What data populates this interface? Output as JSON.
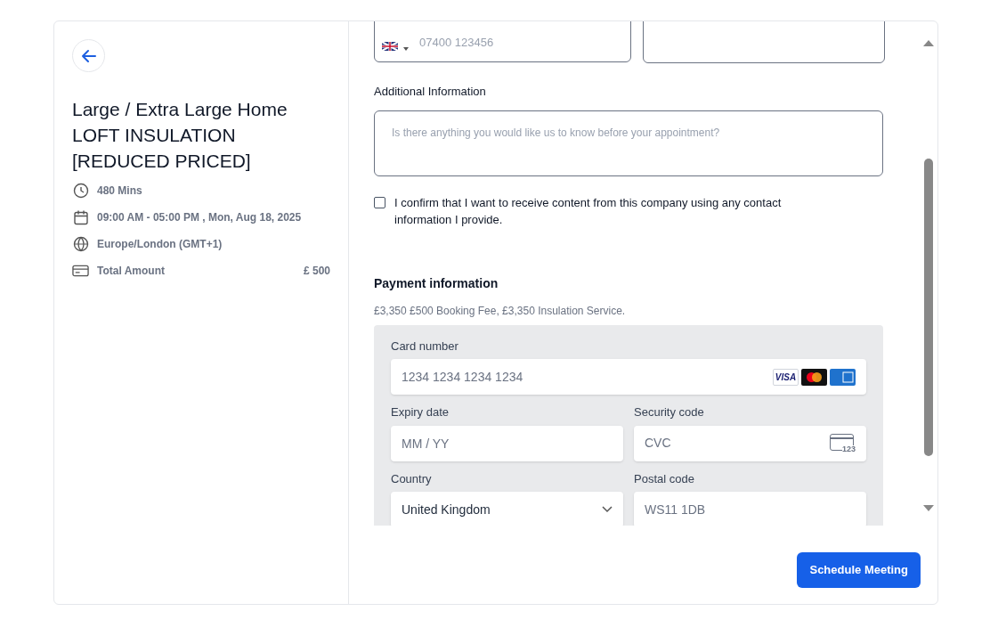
{
  "summary": {
    "title": "Large / Extra Large Home LOFT INSULATION [REDUCED PRICED]",
    "details": [
      {
        "kind": "duration",
        "text": "480 Mins"
      },
      {
        "kind": "date",
        "text": "09:00 AM - 05:00 PM , Mon, Aug 18, 2025"
      },
      {
        "kind": "timezone",
        "text": "Europe/London (GMT+1)"
      },
      {
        "kind": "amount",
        "text": "Total Amount",
        "value": "£ 500"
      }
    ]
  },
  "form": {
    "phone": {
      "placeholder": "07400 123456"
    },
    "additional_info": {
      "label": "Additional Information",
      "placeholder": "Is there anything you would like us to know before your appointment?"
    },
    "consent": {
      "text": "I confirm that I want to receive content from this company using any contact information I provide.",
      "checked": false
    }
  },
  "payment": {
    "title": "Payment information",
    "description": "£3,350 £500 Booking Fee, £3,350 Insulation Service.",
    "card_number": {
      "label": "Card number",
      "placeholder": "1234 1234 1234 1234",
      "visa_text": "VISA"
    },
    "expiry": {
      "label": "Expiry date",
      "placeholder": "MM / YY"
    },
    "security": {
      "label": "Security code",
      "placeholder": "CVC",
      "icon_text": "123"
    },
    "country": {
      "label": "Country",
      "value": "United Kingdom"
    },
    "postal": {
      "label": "Postal code",
      "placeholder": "WS11 1DB"
    }
  },
  "submit": {
    "label": "Schedule Meeting"
  }
}
